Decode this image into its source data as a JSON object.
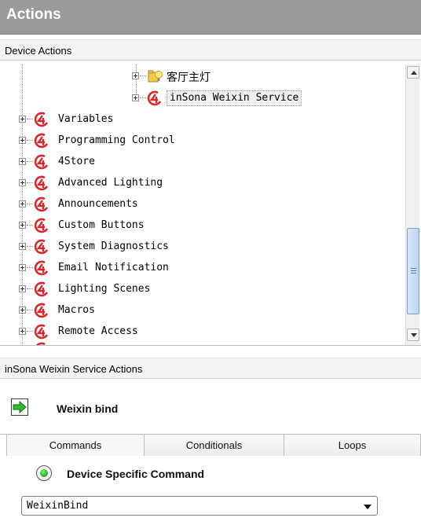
{
  "panel": {
    "title": "Actions"
  },
  "device_actions": {
    "header": "Device Actions",
    "children": [
      {
        "label": "客厅主灯",
        "icon": "folder-bulb-icon"
      },
      {
        "label": "inSona Weixin Service",
        "icon": "control4-logo-icon",
        "selected": true
      }
    ],
    "items": [
      {
        "label": "Variables"
      },
      {
        "label": "Programming Control"
      },
      {
        "label": "4Store"
      },
      {
        "label": "Advanced Lighting"
      },
      {
        "label": "Announcements"
      },
      {
        "label": "Custom Buttons"
      },
      {
        "label": "System Diagnostics"
      },
      {
        "label": "Email Notification"
      },
      {
        "label": "Lighting Scenes"
      },
      {
        "label": "Macros"
      },
      {
        "label": "Remote Access"
      }
    ]
  },
  "service_actions": {
    "header": "inSona Weixin Service Actions",
    "command": {
      "label": "Weixin bind",
      "icon": "green-arrow-icon"
    }
  },
  "tabs": [
    {
      "label": "Commands",
      "active": true
    },
    {
      "label": "Conditionals",
      "active": false
    },
    {
      "label": "Loops",
      "active": false
    }
  ],
  "command_type": {
    "label": "Device Specific Command",
    "selected": true
  },
  "command_select": {
    "value": "WeixinBind"
  },
  "colors": {
    "title_bg": "#9a9a9a",
    "logo_red": "#d8272d",
    "arrow_green": "#2fbf2a",
    "scroll_thumb": "#bcd4ef"
  }
}
